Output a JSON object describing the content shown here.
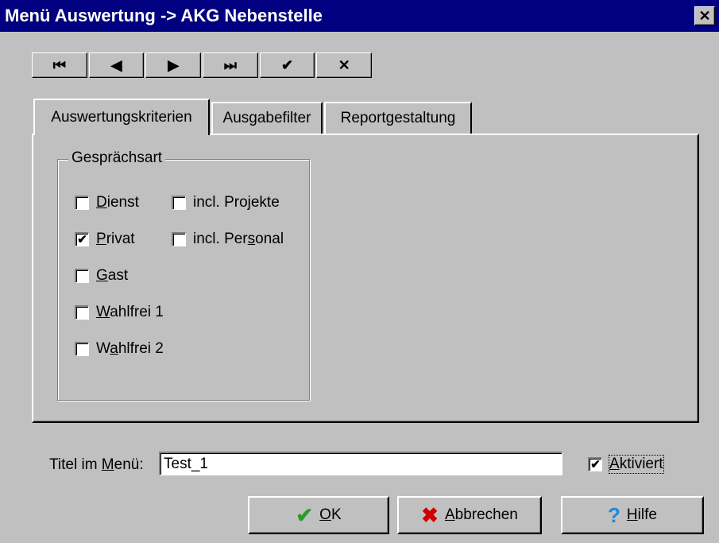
{
  "window": {
    "title": "Menü Auswertung -> AKG Nebenstelle",
    "close_glyph": "✕"
  },
  "nav": [
    {
      "name": "first-record-button",
      "glyph": "⏮"
    },
    {
      "name": "prev-record-button",
      "glyph": "◀"
    },
    {
      "name": "next-record-button",
      "glyph": "▶"
    },
    {
      "name": "last-record-button",
      "glyph": "⏭"
    },
    {
      "name": "confirm-button",
      "glyph": "✔"
    },
    {
      "name": "discard-button",
      "glyph": "✕"
    }
  ],
  "tabs": [
    "Auswertungskriterien",
    "Ausgabefilter",
    "Reportgestaltung"
  ],
  "group": {
    "title": "Gesprächsart",
    "items": [
      {
        "pre": "",
        "mn": "D",
        "post": "ienst",
        "checked": false
      },
      {
        "pre": "",
        "mn": "P",
        "post": "rivat",
        "checked": true
      },
      {
        "pre": "",
        "mn": "G",
        "post": "ast",
        "checked": false
      },
      {
        "pre": "",
        "mn": "W",
        "post": "ahlfrei 1",
        "checked": false
      },
      {
        "pre": "W",
        "mn": "a",
        "post": "hlfrei 2",
        "checked": false
      }
    ],
    "incl": [
      {
        "pre": "incl. Projekte",
        "mn": "",
        "post": "",
        "checked": false
      },
      {
        "pre": "incl. Per",
        "mn": "s",
        "post": "onal",
        "checked": false
      }
    ]
  },
  "titel": {
    "pre": "Titel im ",
    "mn": "M",
    "post": "enü:",
    "value": "Test_1"
  },
  "aktiviert": {
    "pre": "",
    "mn": "A",
    "post": "ktiviert",
    "checked": true
  },
  "buttons": {
    "ok": {
      "pre": "",
      "mn": "O",
      "post": "K",
      "icon": "✔",
      "icon_color": "#2e9a2e"
    },
    "abbrechen": {
      "pre": "",
      "mn": "A",
      "post": "bbrechen",
      "icon": "✖",
      "icon_color": "#d00000"
    },
    "hilfe": {
      "pre": "",
      "mn": "H",
      "post": "ilfe",
      "icon": "?",
      "icon_color": "#1a8ad8"
    }
  }
}
